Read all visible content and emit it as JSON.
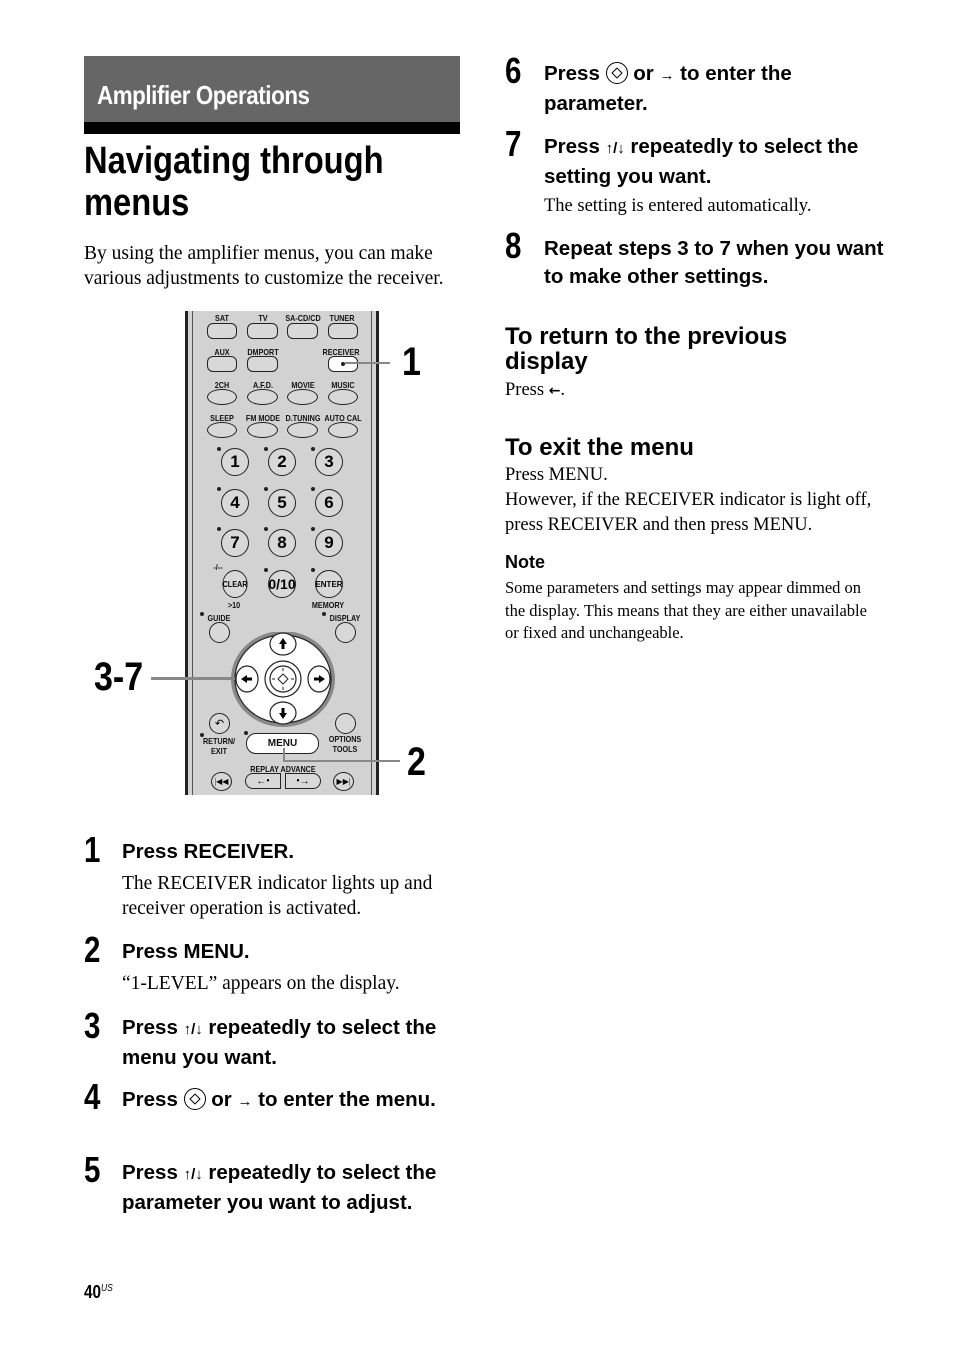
{
  "section": {
    "title": "Amplifier Operations",
    "bar_color": "#666666"
  },
  "page_title": "Navigating through menus",
  "intro": "By using the amplifier menus, you can make various adjustments to customize the receiver.",
  "remote": {
    "row1": [
      "SAT",
      "TV",
      "SA-CD/CD",
      "TUNER"
    ],
    "row2": [
      "AUX",
      "DMPORT",
      "RECEIVER"
    ],
    "row3": [
      "2CH",
      "A.F.D.",
      "MOVIE",
      "MUSIC"
    ],
    "row4": [
      "SLEEP",
      "FM MODE",
      "D.TUNING",
      "AUTO CAL"
    ],
    "numbers": [
      "1",
      "2",
      "3",
      "4",
      "5",
      "6",
      "7",
      "8",
      "9"
    ],
    "dash_label": "-/--",
    "clear": "CLEAR",
    "zero": "0/10",
    "enter": "ENTER",
    "gt10": ">10",
    "memory": "MEMORY",
    "guide": "GUIDE",
    "display": "DISPLAY",
    "return_exit": [
      "RETURN/",
      "EXIT"
    ],
    "menu": "MENU",
    "options_tools": [
      "OPTIONS",
      "TOOLS"
    ],
    "replay_advance": "REPLAY ADVANCE",
    "callouts": {
      "receiver": "1",
      "menu": "2",
      "dpad": "3-7"
    }
  },
  "steps_left": [
    {
      "num": "1",
      "head": "Press RECEIVER.",
      "body": "The RECEIVER indicator lights up and receiver operation is activated."
    },
    {
      "num": "2",
      "head": "Press MENU.",
      "body": "“1-LEVEL” appears on the display."
    },
    {
      "num": "3",
      "head_a": "Press ",
      "arrows": "↑/↓",
      "head_b": " repeatedly to select the menu you want."
    },
    {
      "num": "4",
      "head_a": "Press ",
      "or_text": " or ",
      "arrow": "→",
      "head_b": " to enter the menu."
    },
    {
      "num": "5",
      "head_a": "Press ",
      "arrows": "↑/↓",
      "head_b": " repeatedly to select the parameter you want to adjust."
    }
  ],
  "steps_right": [
    {
      "num": "6",
      "head_a": "Press ",
      "or_text": " or ",
      "arrow": "→",
      "head_b": " to enter the parameter."
    },
    {
      "num": "7",
      "head_a": "Press ",
      "arrows": "↑/↓",
      "head_b": " repeatedly to select the setting you want.",
      "body": "The setting is entered automatically."
    },
    {
      "num": "8",
      "head": "Repeat steps 3 to 7 when you want to make other settings."
    }
  ],
  "return_section": {
    "title": "To return to the previous display",
    "body_a": "Press ",
    "arrow": "←",
    "body_b": "."
  },
  "exit_section": {
    "title": "To exit the menu",
    "line1": "Press MENU.",
    "line2": "However, if the RECEIVER indicator is light off, press RECEIVER and then press MENU."
  },
  "note": {
    "title": "Note",
    "body": "Some parameters and settings may appear dimmed on the display. This means that they are either unavailable or fixed and unchangeable."
  },
  "folio": {
    "page": "40",
    "region": "US"
  }
}
